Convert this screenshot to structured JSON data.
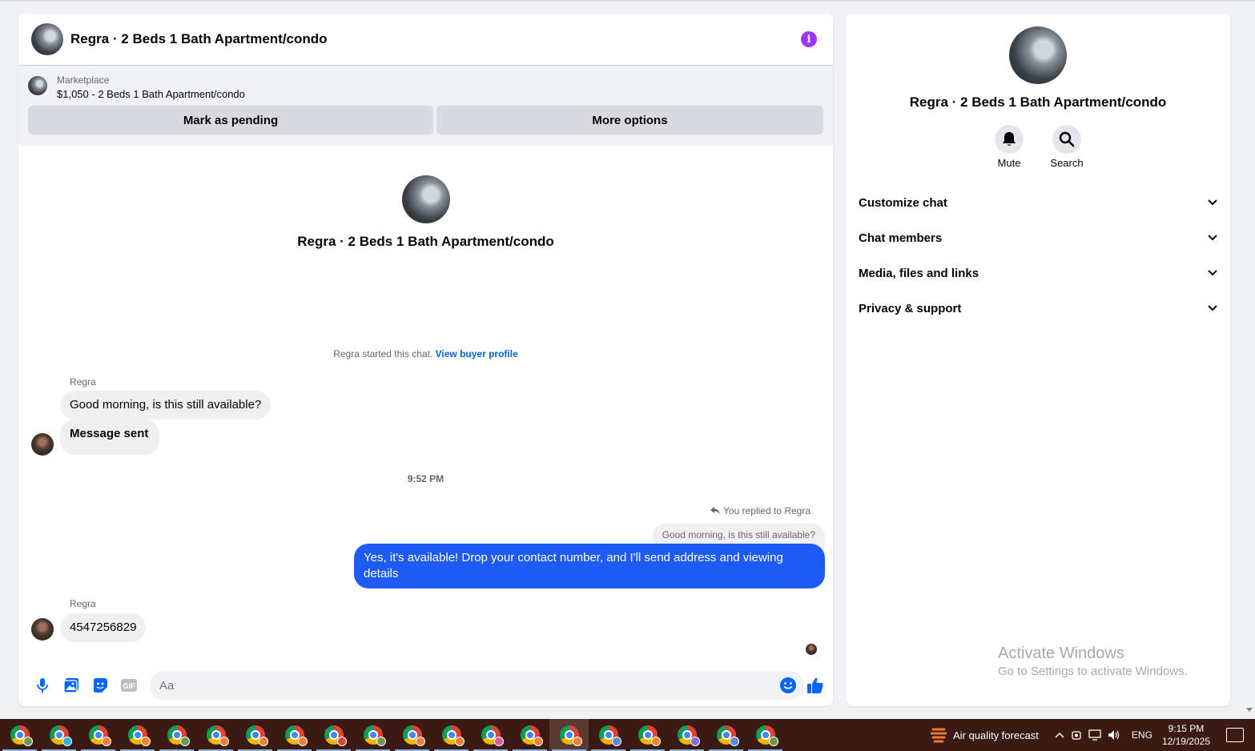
{
  "chat": {
    "title": "Regra · 2 Beds 1 Bath Apartment/condo",
    "listing": {
      "kicker": "Marketplace",
      "description": "$1,050 - 2 Beds 1 Bath Apartment/condo",
      "mark_pending_label": "Mark as pending",
      "more_options_label": "More options"
    },
    "intro_name": "Regra · 2 Beds 1 Bath Apartment/condo",
    "started_text": "Regra started this chat.",
    "view_buyer_profile": "View buyer profile",
    "messages": [
      {
        "sender": "Regra",
        "text": "Good morning, is this still available?"
      },
      {
        "text": "Message sent"
      },
      {
        "timestamp": "9:52 PM"
      },
      {
        "replied_label": "You replied to Regra",
        "quote": "Good morning, is this still available?",
        "text": "Yes, it's available! Drop your contact number, and I'll send address and viewing details"
      },
      {
        "sender": "Regra",
        "text": "4547256829"
      }
    ],
    "composer_placeholder": "Aa"
  },
  "details": {
    "name": "Regra · 2 Beds 1 Bath Apartment/condo",
    "mute_label": "Mute",
    "search_label": "Search",
    "sections": [
      "Customize chat",
      "Chat members",
      "Media, files and links",
      "Privacy & support"
    ]
  },
  "watermark": {
    "title": "Activate Windows",
    "subtitle": "Go to Settings to activate Windows."
  },
  "taskbar": {
    "weather": "Air quality forecast",
    "language": "ENG",
    "time": "9:15 PM",
    "date": "12/19/2025",
    "app_badges": [
      "#6a9955",
      "#2bb3e6",
      "#e8823a",
      "#e8823a",
      "#6a9955",
      "#e8823a",
      "#e8823a",
      "#e8823a",
      "#d64545",
      "#6a9955",
      "#e8823a",
      "#e8823a",
      "#d65aa0",
      "#e8823a",
      "#e8823a",
      "#5a8ad6",
      "#e8823a",
      "#8a6ad6",
      "#5a8ad6",
      "#6a9955"
    ]
  },
  "colors": {
    "accent_blue": "#1e5bf5",
    "link_blue": "#0064d1",
    "info_purple": "#a033ff"
  }
}
